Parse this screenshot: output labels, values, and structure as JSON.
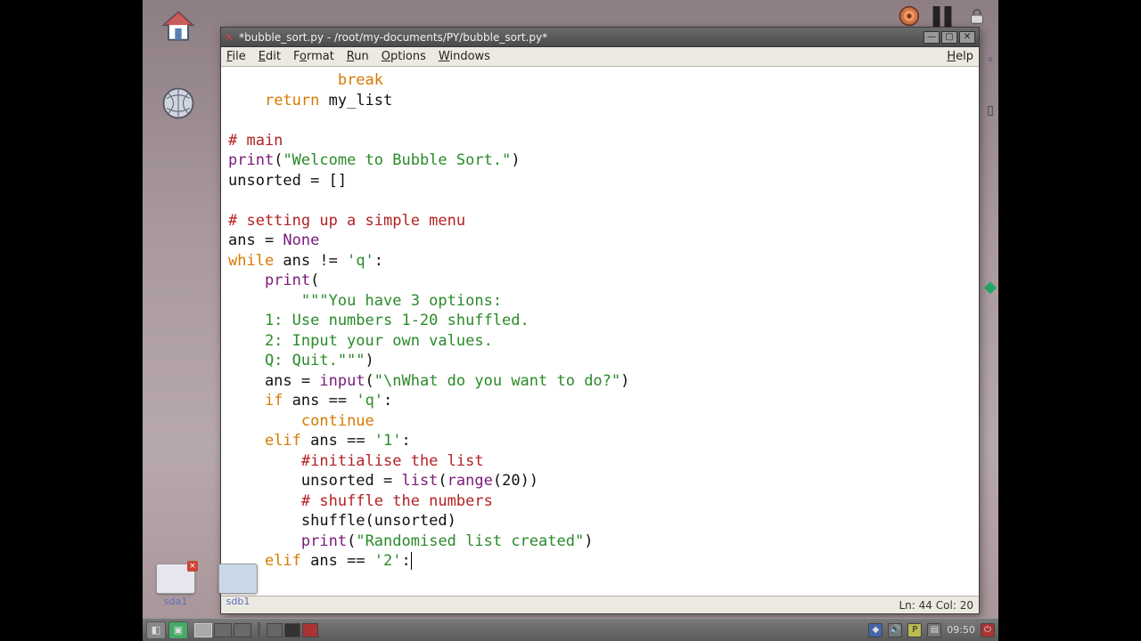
{
  "window": {
    "title": "*bubble_sort.py - /root/my-documents/PY/bubble_sort.py*"
  },
  "menu": {
    "file": "File",
    "edit": "Edit",
    "format": "Format",
    "run": "Run",
    "options": "Options",
    "windows": "Windows",
    "help": "Help"
  },
  "status": {
    "ln_label": "Ln:",
    "ln": "44",
    "col_label": "Col:",
    "col": "20"
  },
  "code": {
    "l1a": "break",
    "l2a": "return",
    "l2b": " my_list",
    "l4a": "# main",
    "l5a": "print",
    "l5b": "(",
    "l5c": "\"Welcome to Bubble Sort.\"",
    "l5d": ")",
    "l6": "unsorted = []",
    "l8a": "# setting up a simple menu",
    "l9a": "ans = ",
    "l9b": "None",
    "l10a": "while",
    "l10b": " ans != ",
    "l10c": "'q'",
    "l10d": ":",
    "l11a": "print",
    "l11b": "(",
    "l12a": "\"\"\"You have 3 options:",
    "l13a": "    1: Use numbers 1-20 shuffled.",
    "l14a": "    2: Input your own values.",
    "l15a": "    Q: Quit.\"\"\"",
    "l15b": ")",
    "l16a": "    ans = ",
    "l16b": "input",
    "l16c": "(",
    "l16d": "\"\\nWhat do you want to do?\"",
    "l16e": ")",
    "l17a": "if",
    "l17b": " ans == ",
    "l17c": "'q'",
    "l17d": ":",
    "l18a": "continue",
    "l19a": "elif",
    "l19b": " ans == ",
    "l19c": "'1'",
    "l19d": ":",
    "l20a": "#initialise the list",
    "l21a": "        unsorted = ",
    "l21b": "list",
    "l21c": "(",
    "l21d": "range",
    "l21e": "(20))",
    "l22a": "# shuffle the numbers",
    "l23a": "        shuffle(unsorted)",
    "l24a": "print",
    "l24b": "(",
    "l24c": "\"Randomised list created\"",
    "l24d": ")",
    "l25a": "elif",
    "l25b": " ans == ",
    "l25c": "'2'",
    "l25d": ":"
  },
  "drives": {
    "a": "sda1",
    "b": "sdb1"
  },
  "taskbar": {
    "clock": "09:50"
  }
}
